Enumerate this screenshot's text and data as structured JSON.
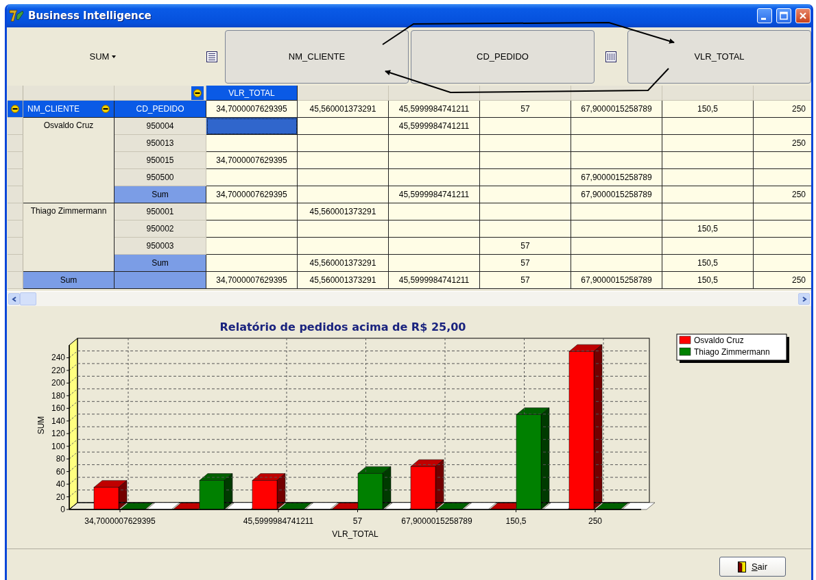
{
  "window": {
    "title": "Business Intelligence"
  },
  "toolbar": {
    "aggregate": "SUM",
    "row_fields": [
      {
        "label": "NM_CLIENTE"
      },
      {
        "label": "CD_PEDIDO"
      }
    ],
    "column_fields": [
      {
        "label": "VLR_TOTAL"
      }
    ]
  },
  "pivot": {
    "column_field": "VLR_TOTAL",
    "row_fields": [
      "NM_CLIENTE",
      "CD_PEDIDO"
    ],
    "column_values": [
      "34,7000007629395",
      "45,560001373291",
      "45,5999984741211",
      "57",
      "67,9000015258789",
      "150,5",
      "250"
    ],
    "groups": [
      {
        "name": "Osvaldo Cruz",
        "rows": [
          {
            "pedido": "950004",
            "selected": true,
            "cells": [
              null,
              null,
              "45,5999984741211",
              null,
              null,
              null,
              null
            ]
          },
          {
            "pedido": "950013",
            "selected": false,
            "cells": [
              null,
              null,
              null,
              null,
              null,
              null,
              "250"
            ]
          },
          {
            "pedido": "950015",
            "selected": false,
            "cells": [
              "34,7000007629395",
              null,
              null,
              null,
              null,
              null,
              null
            ]
          },
          {
            "pedido": "950500",
            "selected": false,
            "cells": [
              null,
              null,
              null,
              null,
              "67,9000015258789",
              null,
              null
            ]
          }
        ],
        "subtotal": {
          "label": "Sum",
          "cells": [
            "34,7000007629395",
            null,
            "45,5999984741211",
            null,
            "67,9000015258789",
            null,
            "250"
          ]
        }
      },
      {
        "name": "Thiago Zimmermann",
        "rows": [
          {
            "pedido": "950001",
            "selected": false,
            "cells": [
              null,
              "45,560001373291",
              null,
              null,
              null,
              null,
              null
            ]
          },
          {
            "pedido": "950002",
            "selected": false,
            "cells": [
              null,
              null,
              null,
              null,
              null,
              "150,5",
              null
            ]
          },
          {
            "pedido": "950003",
            "selected": false,
            "cells": [
              null,
              null,
              null,
              "57",
              null,
              null,
              null
            ]
          }
        ],
        "subtotal": {
          "label": "Sum",
          "cells": [
            null,
            "45,560001373291",
            null,
            "57",
            null,
            "150,5",
            null
          ]
        }
      }
    ],
    "grand_total": {
      "label": "Sum",
      "cells": [
        "34,7000007629395",
        "45,560001373291",
        "45,5999984741211",
        "57",
        "67,9000015258789",
        "150,5",
        "250"
      ]
    }
  },
  "chart": {
    "chart_data": {
      "type": "bar",
      "title": "Relatório de pedidos acima de R$ 25,00",
      "xlabel": "VLR_TOTAL",
      "ylabel": "SUM",
      "categories": [
        "34,7000007629395",
        null,
        "45,5999984741211",
        "57",
        "67,9000015258789",
        "150,5",
        "250"
      ],
      "series": [
        {
          "name": "Osvaldo Cruz",
          "color": "#ff0000",
          "values": [
            35,
            0,
            46,
            0,
            68,
            0,
            250
          ]
        },
        {
          "name": "Thiago Zimmermann",
          "color": "#008000",
          "values": [
            0,
            46,
            0,
            57,
            0,
            150,
            0
          ]
        }
      ],
      "legend": "upper right",
      "ylim": [
        0,
        260
      ],
      "yticks": [
        0,
        20,
        40,
        60,
        80,
        100,
        120,
        140,
        160,
        180,
        200,
        220,
        240
      ]
    }
  },
  "buttons": [
    {
      "label": "Sair"
    }
  ]
}
